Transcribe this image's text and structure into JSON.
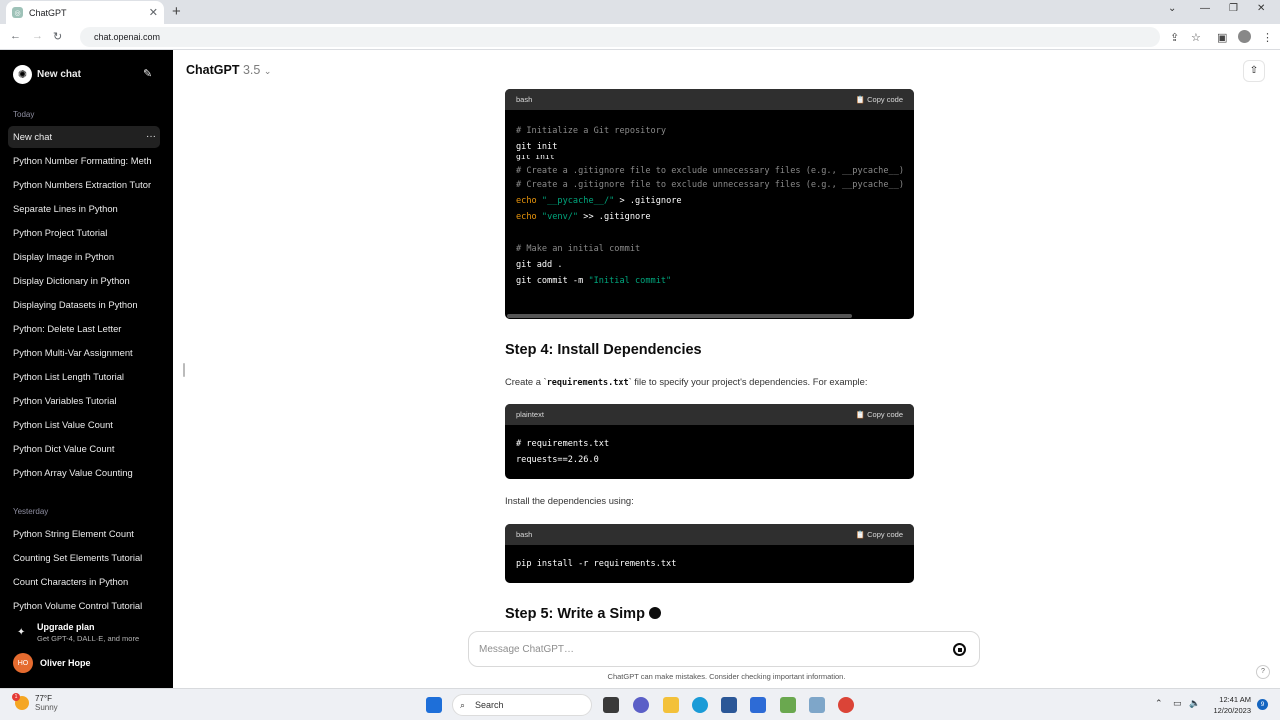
{
  "browser": {
    "tab_title": "ChatGPT",
    "url": "chat.openai.com"
  },
  "sidebar": {
    "new_chat_label": "New chat",
    "sections": [
      {
        "title": "Today",
        "items": [
          "New chat",
          "Python Number Formatting: Meth",
          "Python Numbers Extraction Tutor",
          "Separate Lines in Python",
          "Python Project Tutorial",
          "Display Image in Python",
          "Display Dictionary in Python",
          "Displaying Datasets in Python",
          "Python: Delete Last Letter",
          "Python Multi-Var Assignment",
          "Python List Length Tutorial",
          "Python Variables Tutorial",
          "Python List Value Count",
          "Python Dict Value Count",
          "Python Array Value Counting"
        ]
      },
      {
        "title": "Yesterday",
        "items": [
          "Python String Element Count",
          "Counting Set Elements Tutorial",
          "Count Characters in Python",
          "Python Volume Control Tutorial"
        ]
      }
    ],
    "upgrade": {
      "title": "Upgrade plan",
      "subtitle": "Get GPT-4, DALL·E, and more"
    },
    "user": {
      "initials": "HO",
      "name": "Oliver Hope"
    }
  },
  "header": {
    "model": "ChatGPT",
    "version": "3.5"
  },
  "content": {
    "copy_label": "Copy code",
    "block1": {
      "lang": "bash",
      "lines": [
        [
          {
            "c": "cm",
            "t": "# Initialize a Git repository"
          }
        ],
        [
          {
            "c": "",
            "t": "git init"
          }
        ],
        [
          {
            "c": "",
            "t": "git init"
          }
        ],
        [
          {
            "c": "cm",
            "t": "# Create a .gitignore file to exclude unnecessary files (e.g., __pycache__)"
          }
        ],
        [
          {
            "c": "cm",
            "t": "# Create a .gitignore file to exclude unnecessary files (e.g., __pycache__)"
          }
        ],
        [
          {
            "c": "kw",
            "t": "echo"
          },
          {
            "c": "",
            "t": " "
          },
          {
            "c": "str",
            "t": "\"__pycache__/\""
          },
          {
            "c": "",
            "t": " > .gitignore"
          }
        ],
        [
          {
            "c": "kw",
            "t": "echo"
          },
          {
            "c": "",
            "t": " "
          },
          {
            "c": "str",
            "t": "\"venv/\""
          },
          {
            "c": "",
            "t": " >> .gitignore"
          }
        ],
        [
          {
            "c": "",
            "t": ""
          }
        ],
        [
          {
            "c": "cm",
            "t": "# Make an initial commit"
          }
        ],
        [
          {
            "c": "",
            "t": "git add ."
          }
        ],
        [
          {
            "c": "",
            "t": "git commit -m "
          },
          {
            "c": "str",
            "t": "\"Initial commit\""
          }
        ]
      ]
    },
    "step4": "Step 4: Install Dependencies",
    "para1_a": "Create a `",
    "para1_code": "requirements.txt",
    "para1_b": "` file to specify your project's dependencies. For example:",
    "block2": {
      "lang": "plaintext",
      "lines": [
        [
          {
            "c": "",
            "t": "# requirements.txt"
          }
        ],
        [
          {
            "c": "",
            "t": "requests==2.26.0"
          }
        ]
      ]
    },
    "para2": "Install the dependencies using:",
    "block3": {
      "lang": "bash",
      "lines": [
        [
          {
            "c": "",
            "t": "pip install -r requirements.txt"
          }
        ]
      ]
    },
    "step5": "Step 5: Write a Simp"
  },
  "composer": {
    "placeholder": "Message ChatGPT…",
    "disclaimer": "ChatGPT can make mistakes. Consider checking important information."
  },
  "taskbar": {
    "weather_temp": "77°F",
    "weather_desc": "Sunny",
    "weather_badge": "1",
    "search_label": "Search",
    "time": "12:41 AM",
    "date": "12/20/2023",
    "notification_count": "9"
  }
}
